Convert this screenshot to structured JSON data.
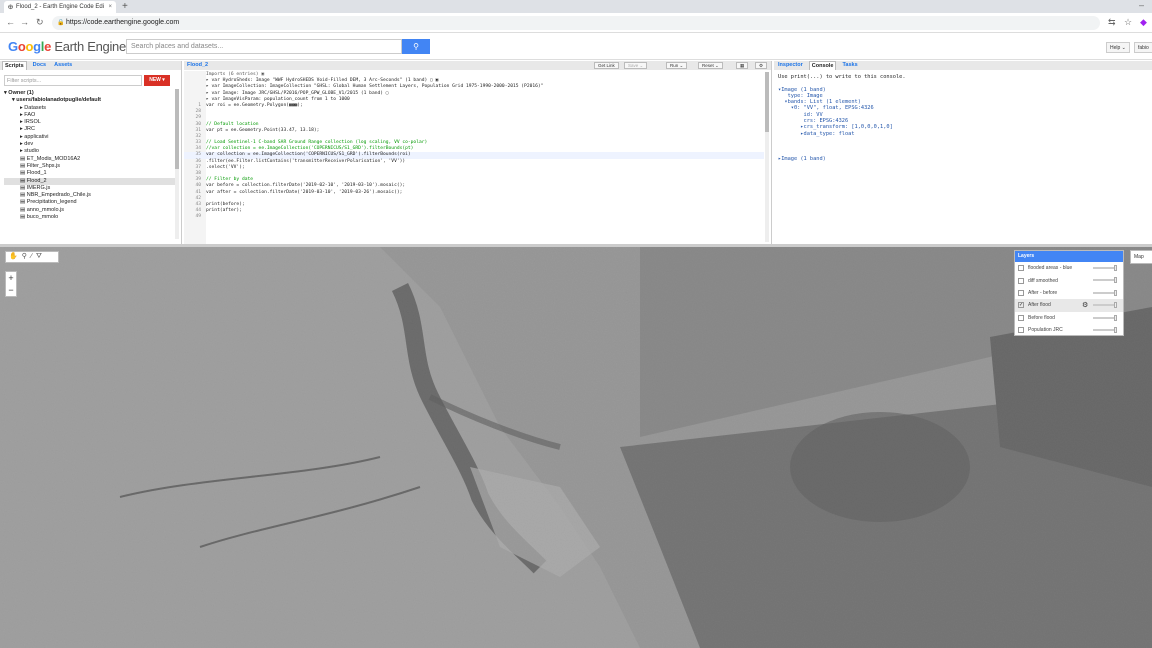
{
  "browser": {
    "tab_title": "Flood_2 - Earth Engine Code Edi",
    "url": "https://code.earthengine.google.com",
    "new_tab": "+",
    "close": "×",
    "minimize": "–"
  },
  "header": {
    "logo_g": [
      "G",
      "o",
      "o",
      "g",
      "l",
      "e"
    ],
    "logo_rest": " Earth Engine",
    "search_placeholder": "Search places and datasets...",
    "help": "Help ⌄",
    "user": "fabio"
  },
  "left_panel": {
    "tabs": [
      "Scripts",
      "Docs",
      "Assets"
    ],
    "filter_placeholder": "Filter scripts...",
    "new_button": "NEW ▾",
    "tree": [
      {
        "label": "▾ Owner (1)",
        "indent": 0,
        "bold": true
      },
      {
        "label": "▾ users/fabiolanadotpuglie/default",
        "indent": 1,
        "bold": true
      },
      {
        "label": "▸ Datasets",
        "indent": 2
      },
      {
        "label": "▸ FAO",
        "indent": 2
      },
      {
        "label": "▸ IRSOL",
        "indent": 2
      },
      {
        "label": "▸ JRC",
        "indent": 2
      },
      {
        "label": "▸ applicativi",
        "indent": 2
      },
      {
        "label": "▸ dev",
        "indent": 2
      },
      {
        "label": "▸ studio",
        "indent": 2
      },
      {
        "label": "▤ ET_Modis_MOD16A2",
        "indent": 2
      },
      {
        "label": "▤ Filter_Shps.js",
        "indent": 2
      },
      {
        "label": "▤ Flood_1",
        "indent": 2
      },
      {
        "label": "▤ Flood_2",
        "indent": 2,
        "selected": true
      },
      {
        "label": "▤ IMERG.js",
        "indent": 2
      },
      {
        "label": "▤ NBR_Empedrado_Chile.js",
        "indent": 2
      },
      {
        "label": "▤ Precipitation_legend",
        "indent": 2
      },
      {
        "label": "▤ anno_mmolo.js",
        "indent": 2
      },
      {
        "label": "▤ buco_mmolo",
        "indent": 2
      }
    ]
  },
  "editor": {
    "title": "Flood_2",
    "buttons": [
      "Get Link",
      "Save ⌄",
      "Run ⌄",
      "Reset ⌄"
    ],
    "imports_header": "Imports (6 entries) ▣",
    "import_lines": [
      "▸ var HydroSheds: Image \"WWF HydroSHEDS Void-Filled DEM, 3 Arc-Seconds\" (1 band) ▢ ▣",
      "▸ var ImageCollection: ImageCollection \"GHSL: Global Human Settlement Layers, Population Grid 1975-1990-2000-2015 (P2016)\"",
      "▸ var Image: Image JRC/GHSL/P2016/POP_GPW_GLOBE_V1/2015 (1 band) ▢",
      "▸ var ImageVisParam: population_count from 1 to 1000"
    ],
    "lines": [
      {
        "n": "1",
        "t": "var roi = ee.Geometry.Polygon(▩▩▩);",
        "k": "code"
      },
      {
        "n": "28",
        "t": "",
        "k": "code"
      },
      {
        "n": "29",
        "t": "",
        "k": "code"
      },
      {
        "n": "30",
        "t": "// Default location",
        "k": "comment"
      },
      {
        "n": "31",
        "t": "var pt = ee.Geometry.Point(33.47, 13.18);",
        "k": "code"
      },
      {
        "n": "32",
        "t": "",
        "k": "code"
      },
      {
        "n": "33",
        "t": "// Load Sentinel-1 C-band SAR Ground Range collection (log scaling, VV co-polar)",
        "k": "comment"
      },
      {
        "n": "34",
        "t": "//var collection = ee.ImageCollection('COPERNICUS/S1_GRD').filterBounds(pt)",
        "k": "comment"
      },
      {
        "n": "35",
        "t": "var collection = ee.ImageCollection('COPERNICUS/S1_GRD').filterBounds(roi)",
        "k": "code",
        "hl": true
      },
      {
        "n": "36",
        "t": ".filter(ee.Filter.listContains('transmitterReceiverPolarisation', 'VV'))",
        "k": "code"
      },
      {
        "n": "37",
        "t": ".select('VV');",
        "k": "code"
      },
      {
        "n": "38",
        "t": "",
        "k": "code"
      },
      {
        "n": "39",
        "t": "// Filter by date",
        "k": "comment"
      },
      {
        "n": "40",
        "t": "var before = collection.filterDate('2019-02-10', '2019-03-10').mosaic();",
        "k": "code"
      },
      {
        "n": "41",
        "t": "var after = collection.filterDate('2019-03-10', '2019-03-26').mosaic();",
        "k": "code"
      },
      {
        "n": "42",
        "t": "",
        "k": "code"
      },
      {
        "n": "43",
        "t": "print(before);",
        "k": "code"
      },
      {
        "n": "44",
        "t": "print(after);",
        "k": "code"
      },
      {
        "n": "49",
        "t": "",
        "k": "code"
      }
    ]
  },
  "right_panel": {
    "tabs": [
      "Inspector",
      "Console",
      "Tasks"
    ],
    "console_hint": "Use print(...) to write to this console.",
    "image1_lines": [
      "▾Image (1 band)",
      "   type: Image",
      "  ▾bands: List (1 element)",
      "    ▾0: \"VV\", float, EPSG:4326",
      "        id: VV",
      "        crs: EPSG:4326",
      "       ▸crs_transform: [1,0,0,0,1,0]",
      "       ▸data_type: float"
    ],
    "image2_line": "▸Image (1 band)"
  },
  "map": {
    "tools": [
      "✋",
      "⚲",
      "∕",
      "⛛"
    ],
    "zoom_in": "+",
    "zoom_out": "−",
    "layers_title": "Layers",
    "layers": [
      {
        "name": "flooded areas - blue",
        "checked": false
      },
      {
        "name": "diff smoothed",
        "checked": false
      },
      {
        "name": "After - before",
        "checked": false
      },
      {
        "name": "After flood",
        "checked": true,
        "highlight": true
      },
      {
        "name": "Before flood",
        "checked": false
      },
      {
        "name": "Population JRC",
        "checked": false
      }
    ],
    "map_button": "Map"
  }
}
